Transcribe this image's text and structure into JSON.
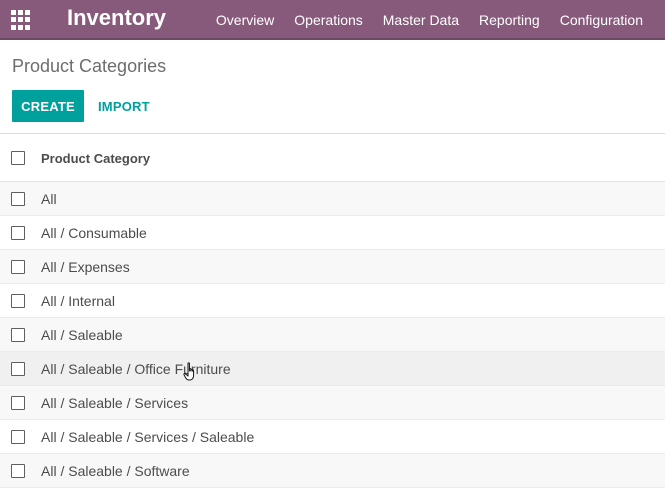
{
  "topbar": {
    "app_name": "Inventory",
    "menu": [
      "Overview",
      "Operations",
      "Master Data",
      "Reporting",
      "Configuration"
    ]
  },
  "control_panel": {
    "title": "Product Categories",
    "create_label": "CREATE",
    "import_label": "IMPORT"
  },
  "list": {
    "column_header": "Product Category",
    "rows": [
      "All",
      "All / Consumable",
      "All / Expenses",
      "All / Internal",
      "All / Saleable",
      "All / Saleable / Office Furniture",
      "All / Saleable / Services",
      "All / Saleable / Services / Saleable",
      "All / Saleable / Software"
    ]
  },
  "colors": {
    "topbar": "#875a7b",
    "accent": "#00a09d"
  },
  "icons": {
    "apps": "apps-grid-icon",
    "cursor": "hand-cursor-icon"
  }
}
